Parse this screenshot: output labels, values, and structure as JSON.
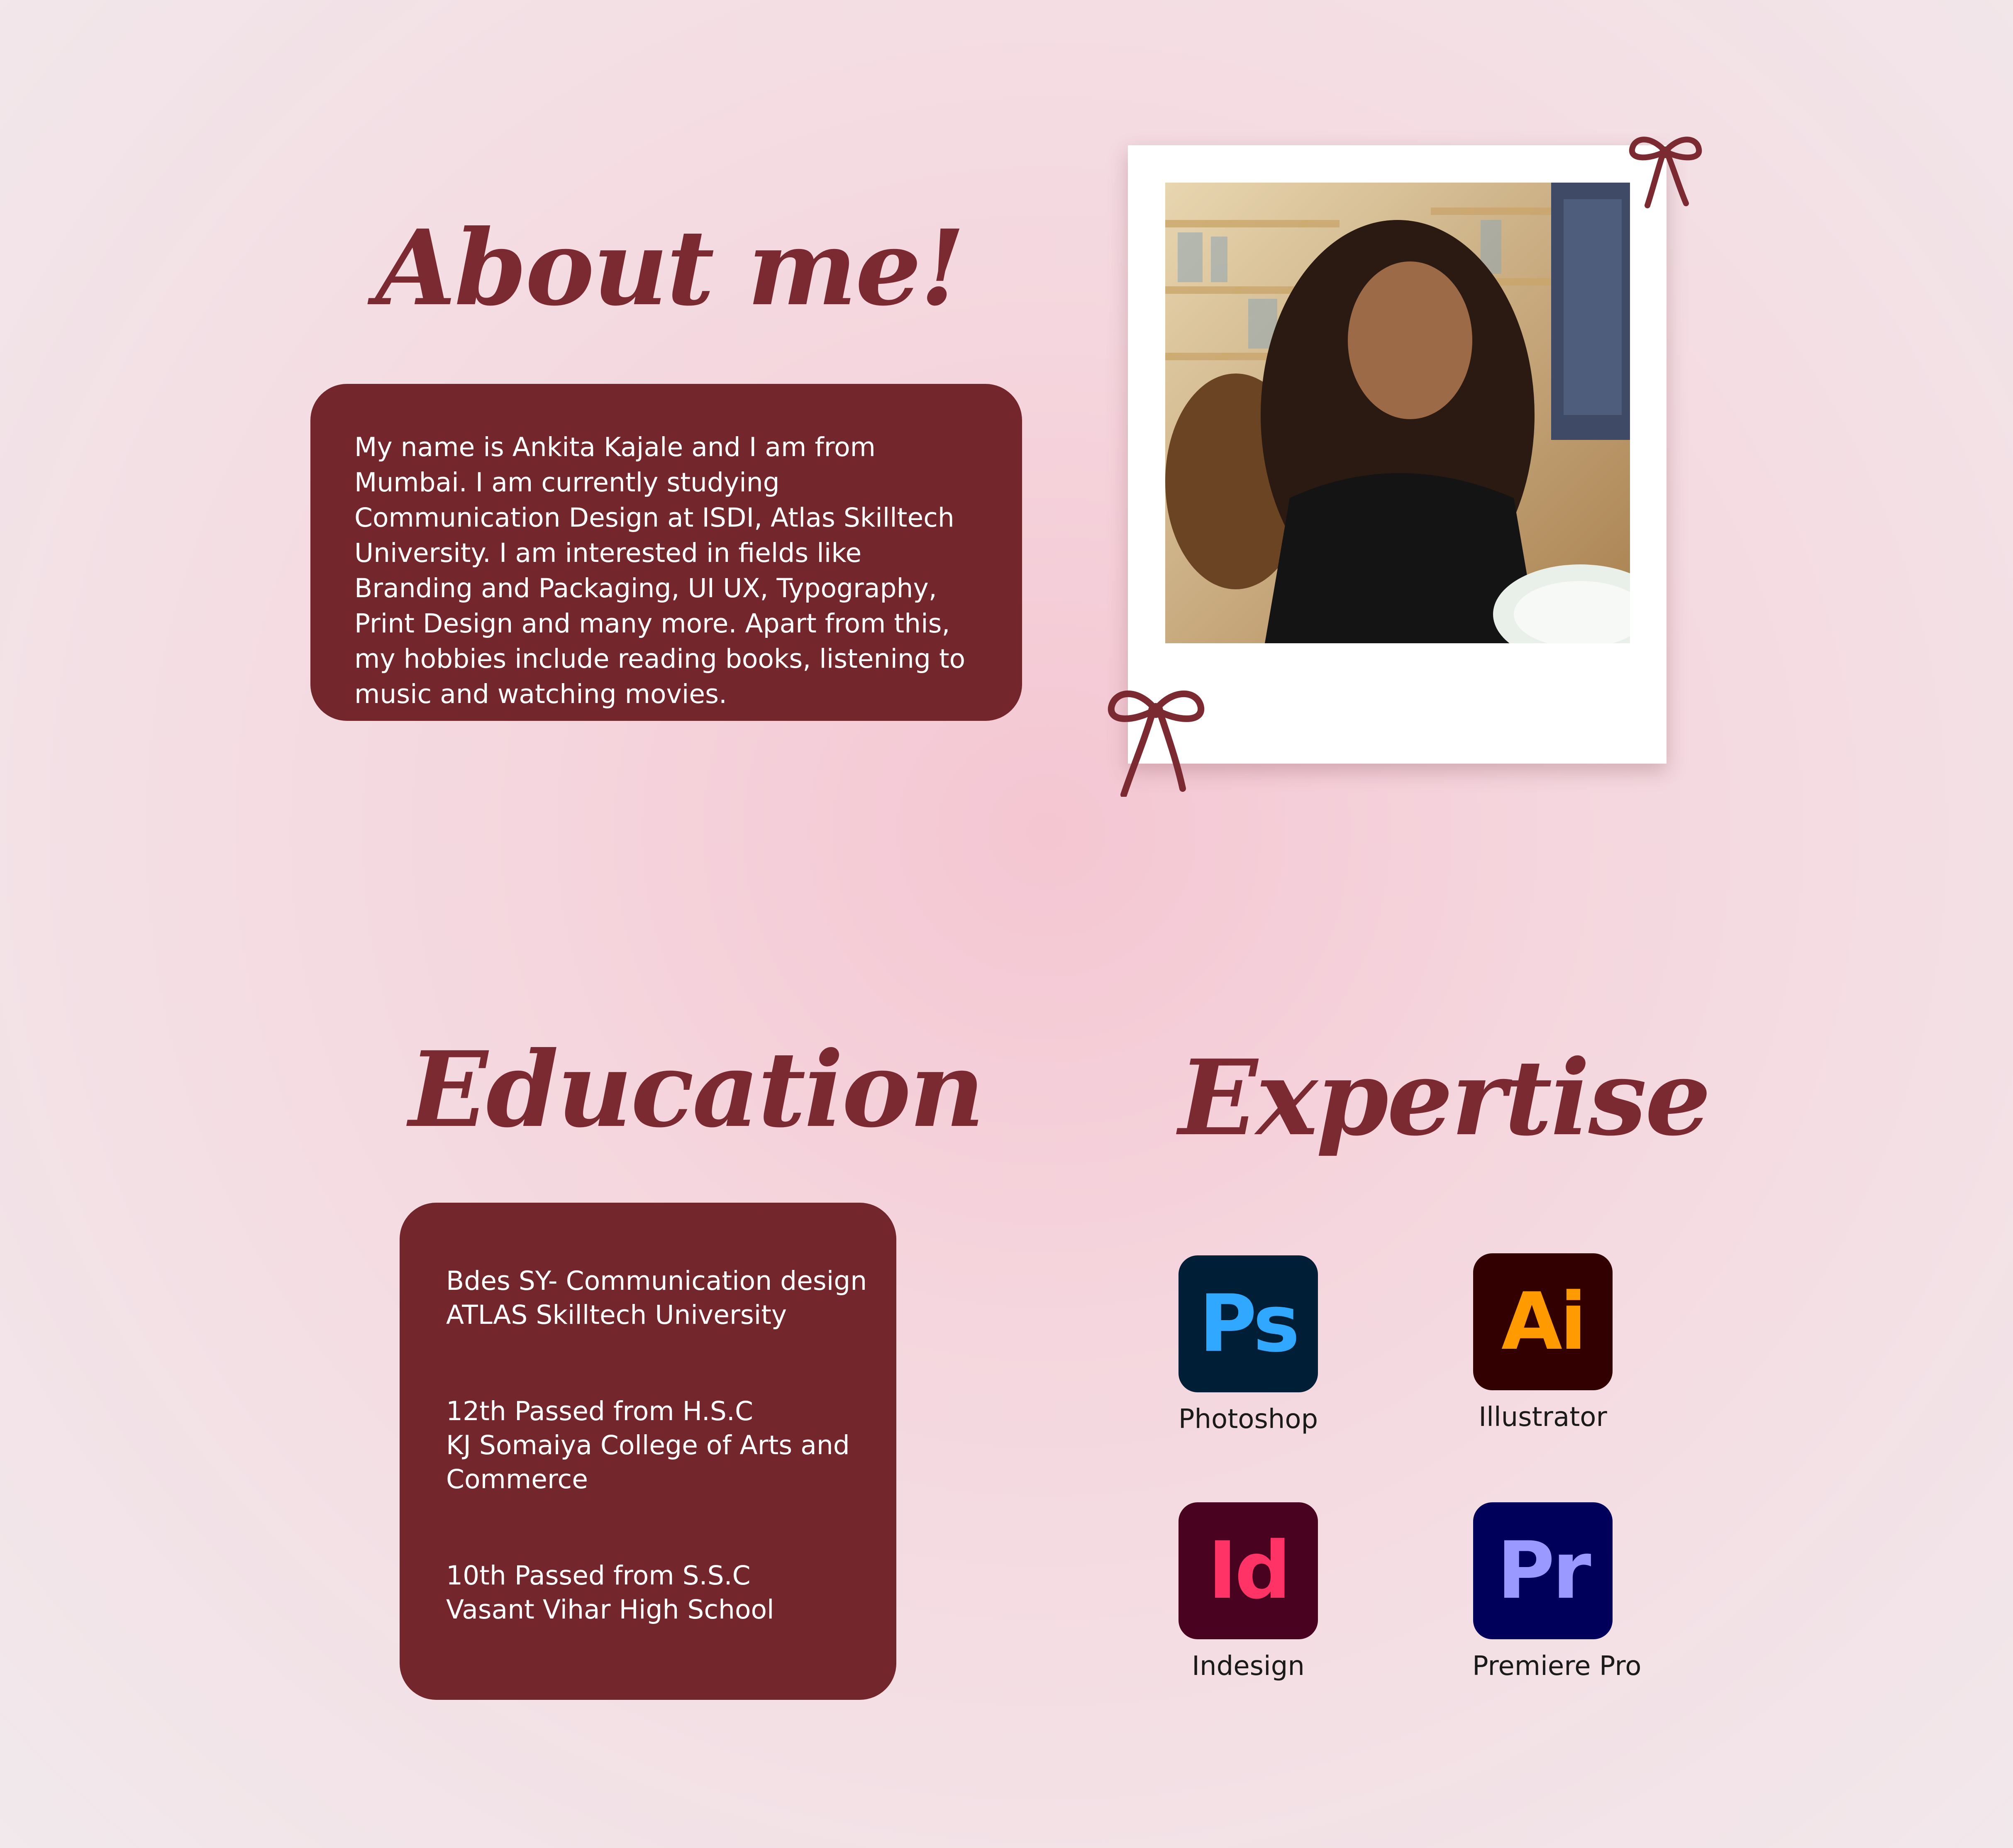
{
  "about": {
    "heading": "About me!",
    "bio": "My name is Ankita Kajale and I am from Mumbai. I am currently studying Communication Design at ISDI, Atlas Skilltech University. I am interested in fields like Branding and Packaging, UI UX, Typography, Print Design and many more. Apart from this, my hobbies include reading books, listening to music and watching movies."
  },
  "education": {
    "heading": "Education",
    "entries": [
      {
        "line1": "Bdes SY- Communication design",
        "line2": "ATLAS Skilltech University",
        "line3": ""
      },
      {
        "line1": "12th Passed from H.S.C",
        "line2": "KJ Somaiya College of Arts and",
        "line3": "Commerce"
      },
      {
        "line1": "10th Passed from S.S.C",
        "line2": "Vasant Vihar High School",
        "line3": ""
      }
    ]
  },
  "expertise": {
    "heading": "Expertise",
    "tools": [
      {
        "abbr": "Ps",
        "label": "Photoshop",
        "icon_bg": "#001e36",
        "icon_fg": "#31a8ff"
      },
      {
        "abbr": "Ai",
        "label": "Illustrator",
        "icon_bg": "#330000",
        "icon_fg": "#ff9a00"
      },
      {
        "abbr": "Id",
        "label": "Indesign",
        "icon_bg": "#49021f",
        "icon_fg": "#ff3366"
      },
      {
        "abbr": "Pr",
        "label": "Premiere Pro",
        "icon_bg": "#00005b",
        "icon_fg": "#9999ff"
      }
    ]
  },
  "colors": {
    "accent": "#7b2a31",
    "card": "#73262b",
    "background": "#f4d3dc"
  },
  "icons": [
    "ribbon-bow-icon",
    "photoshop-icon",
    "illustrator-icon",
    "indesign-icon",
    "premiere-pro-icon"
  ]
}
